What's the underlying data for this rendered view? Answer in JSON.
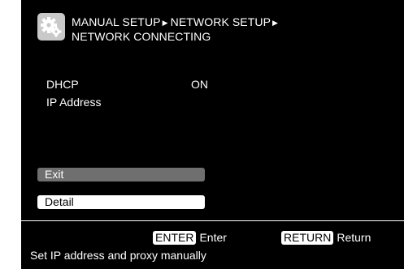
{
  "header": {
    "breadcrumb": [
      "MANUAL SETUP",
      "NETWORK SETUP"
    ],
    "current": "NETWORK CONNECTING",
    "icon": "gear-icon"
  },
  "settings": [
    {
      "label": "DHCP",
      "value": "ON"
    },
    {
      "label": "IP Address",
      "value": ""
    }
  ],
  "buttons": {
    "exit": "Exit",
    "detail": "Detail"
  },
  "footer": {
    "enter_key": "ENTER",
    "enter_label": "Enter",
    "return_key": "RETURN",
    "return_label": "Return",
    "hint": "Set IP address and proxy manually"
  },
  "colors": {
    "background": "#000000",
    "text": "#ffffff",
    "exit_button": "#6f6f6f",
    "detail_button": "#ffffff"
  }
}
